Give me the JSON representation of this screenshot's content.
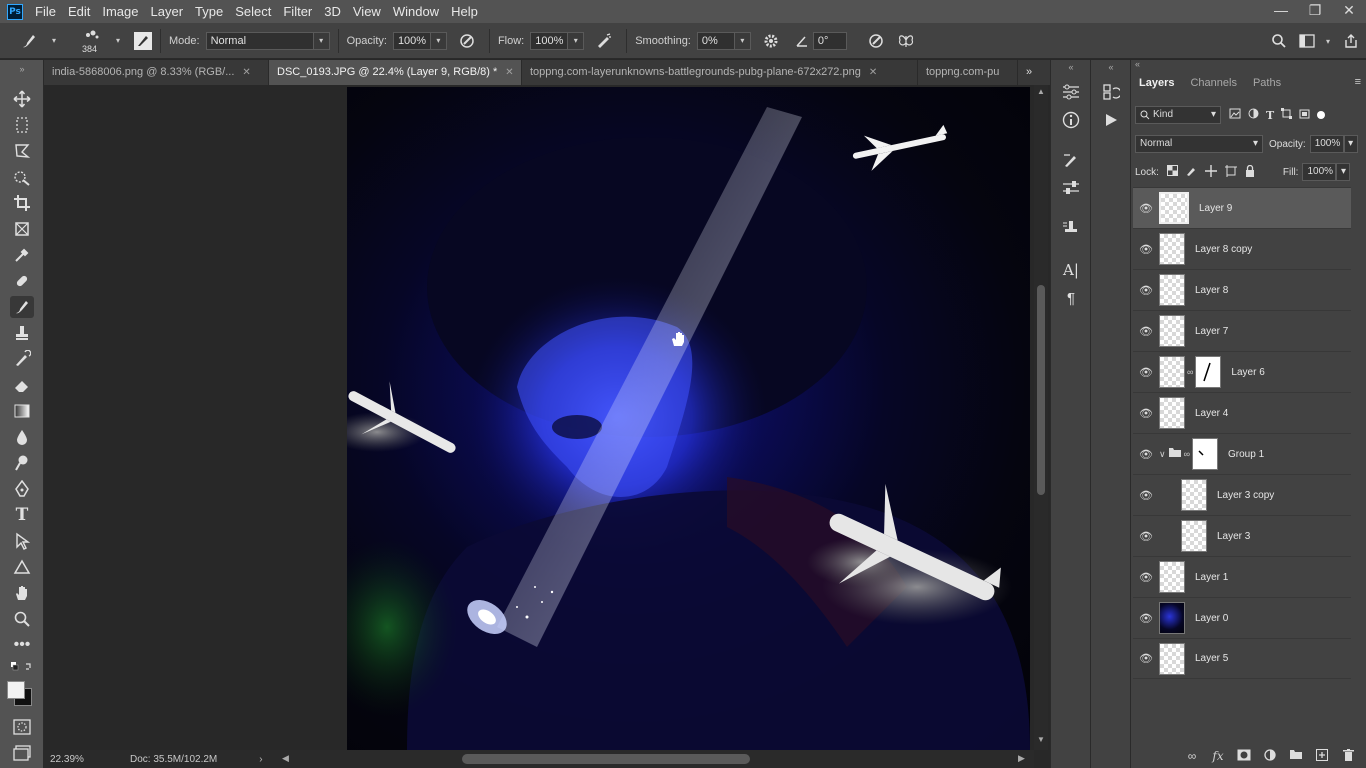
{
  "menubar": {
    "logo": "Ps",
    "items": [
      "File",
      "Edit",
      "Image",
      "Layer",
      "Type",
      "Select",
      "Filter",
      "3D",
      "View",
      "Window",
      "Help"
    ],
    "controls": [
      "—",
      "❐",
      "✕"
    ]
  },
  "options": {
    "brush_size": "384",
    "mode_label": "Mode:",
    "mode_value": "Normal",
    "opacity_label": "Opacity:",
    "opacity_value": "100%",
    "flow_label": "Flow:",
    "flow_value": "100%",
    "smoothing_label": "Smoothing:",
    "smoothing_value": "0%",
    "angle_value": "0°"
  },
  "tabs": [
    {
      "label": "india-5868006.png @ 8.33% (RGB/...",
      "close": "✕",
      "active": false
    },
    {
      "label": "DSC_0193.JPG @ 22.4% (Layer 9, RGB/8) *",
      "close": "✕",
      "active": true
    },
    {
      "label": "toppng.com-layerunknowns-battlegrounds-pubg-plane-672x272.png",
      "close": "✕",
      "active": false
    },
    {
      "label": "toppng.com-pu",
      "close": "",
      "active": false
    }
  ],
  "status": {
    "zoom": "22.39%",
    "doc": "Doc: 35.5M/102.2M"
  },
  "layers_panel": {
    "tabs": [
      "Layers",
      "Channels",
      "Paths"
    ],
    "kind_label": "Kind",
    "blend_mode": "Normal",
    "opacity_label": "Opacity:",
    "opacity_value": "100%",
    "lock_label": "Lock:",
    "fill_label": "Fill:",
    "fill_value": "100%",
    "layers": [
      {
        "name": "Layer 9",
        "selected": true,
        "indent": false,
        "mask": false,
        "group": false
      },
      {
        "name": "Layer 8 copy",
        "selected": false,
        "indent": false,
        "mask": false,
        "group": false
      },
      {
        "name": "Layer 8",
        "selected": false,
        "indent": false,
        "mask": false,
        "group": false
      },
      {
        "name": "Layer 7",
        "selected": false,
        "indent": false,
        "mask": false,
        "group": false
      },
      {
        "name": "Layer 6",
        "selected": false,
        "indent": false,
        "mask": true,
        "group": false
      },
      {
        "name": "Layer 4",
        "selected": false,
        "indent": false,
        "mask": false,
        "group": false
      },
      {
        "name": "Group 1",
        "selected": false,
        "indent": false,
        "mask": true,
        "group": true
      },
      {
        "name": "Layer 3 copy",
        "selected": false,
        "indent": true,
        "mask": false,
        "group": false
      },
      {
        "name": "Layer 3",
        "selected": false,
        "indent": true,
        "mask": false,
        "group": false
      },
      {
        "name": "Layer 1",
        "selected": false,
        "indent": false,
        "mask": false,
        "group": false
      },
      {
        "name": "Layer 0",
        "selected": false,
        "indent": false,
        "mask": false,
        "group": false
      },
      {
        "name": "Layer 5",
        "selected": false,
        "indent": false,
        "mask": false,
        "group": false
      }
    ]
  },
  "colors": {
    "accent": "#31a8ff",
    "panel_bg": "#424242",
    "menubar_bg": "#535353"
  }
}
